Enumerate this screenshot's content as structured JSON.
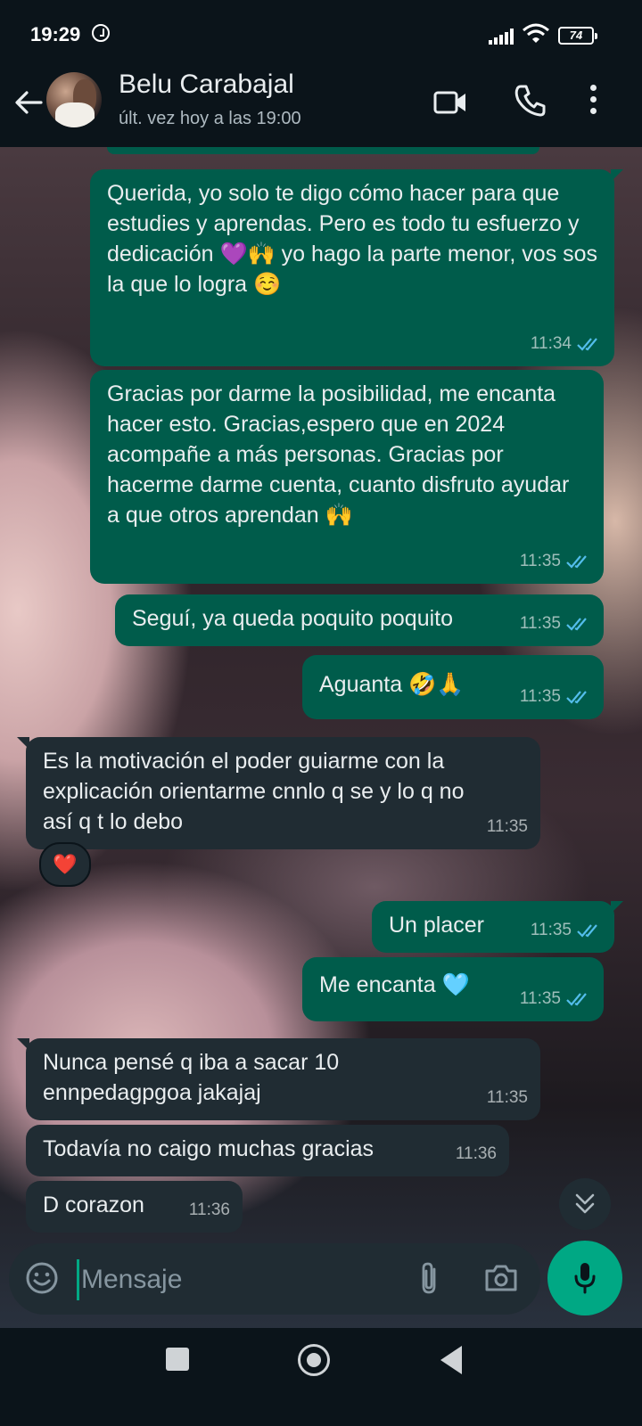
{
  "status_bar": {
    "time": "19:29",
    "battery": "74"
  },
  "header": {
    "contact_name": "Belu Carabajal",
    "last_seen": "últ. vez hoy a las 19:00"
  },
  "colors": {
    "outgoing": "#005c4b",
    "incoming": "#202c33",
    "accent": "#00a884",
    "read_ticks": "#53bdeb"
  },
  "messages": [
    {
      "direction": "out",
      "text": "Querida, yo solo te digo cómo hacer para que estudies y aprendas. Pero es todo tu esfuerzo y dedicación 💜🙌 yo hago la parte menor, vos sos la que lo logra ☺️",
      "time": "11:34",
      "status": "read"
    },
    {
      "direction": "out",
      "text": "Gracias por darme la posibilidad, me encanta hacer esto. Gracias,espero que en 2024 acompañe a más personas. Gracias por hacerme darme cuenta, cuanto disfruto ayudar a que otros aprendan 🙌",
      "time": "11:35",
      "status": "read"
    },
    {
      "direction": "out",
      "text": "Seguí, ya queda poquito poquito",
      "time": "11:35",
      "status": "read"
    },
    {
      "direction": "out",
      "text": "Aguanta 🤣🙏",
      "time": "11:35",
      "status": "read"
    },
    {
      "direction": "in",
      "text": "Es la motivación el poder guiarme con la explicación orientarme cnnlo q se y lo q no así q t lo debo",
      "time": "11:35",
      "reaction": "❤️"
    },
    {
      "direction": "out",
      "text": "Un placer",
      "time": "11:35",
      "status": "read"
    },
    {
      "direction": "out",
      "text": "Me encanta 🩵",
      "time": "11:35",
      "status": "read"
    },
    {
      "direction": "in",
      "text": "Nunca pensé q iba a sacar 10 ennpedagpgoa jakajaj",
      "time": "11:35"
    },
    {
      "direction": "in",
      "text": "Todavía no caigo muchas gracias",
      "time": "11:36"
    },
    {
      "direction": "in",
      "text": "D corazon",
      "time": "11:36"
    }
  ],
  "input": {
    "placeholder": "Mensaje",
    "value": ""
  },
  "icons": {
    "back": "arrow-left",
    "video": "video-camera",
    "call": "phone",
    "menu": "more-vertical",
    "emoji": "smiley",
    "attach": "paperclip",
    "camera": "camera",
    "mic": "microphone",
    "scroll": "double-chevron-down"
  }
}
